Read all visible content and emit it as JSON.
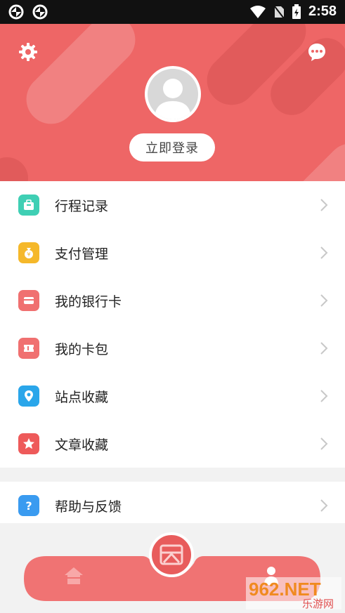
{
  "status_bar": {
    "time": "2:58"
  },
  "header": {
    "login_label": "立即登录",
    "accent_color": "#ee6666"
  },
  "menu": [
    {
      "label": "行程记录",
      "icon": "luggage-icon",
      "color": "#3fcfb4"
    },
    {
      "label": "支付管理",
      "icon": "money-bag-icon",
      "color": "#f5b82a"
    },
    {
      "label": "我的银行卡",
      "icon": "bank-card-icon",
      "color": "#f07070"
    },
    {
      "label": "我的卡包",
      "icon": "ticket-icon",
      "color": "#f07070"
    },
    {
      "label": "站点收藏",
      "icon": "location-pin-icon",
      "color": "#2aa6ea"
    },
    {
      "label": "文章收藏",
      "icon": "star-icon",
      "color": "#ee5a5a"
    }
  ],
  "menu2": [
    {
      "label": "帮助与反馈",
      "icon": "question-icon",
      "color": "#3a9bf0"
    }
  ],
  "watermark": {
    "text": "962.NET",
    "sub": "乐游网"
  }
}
